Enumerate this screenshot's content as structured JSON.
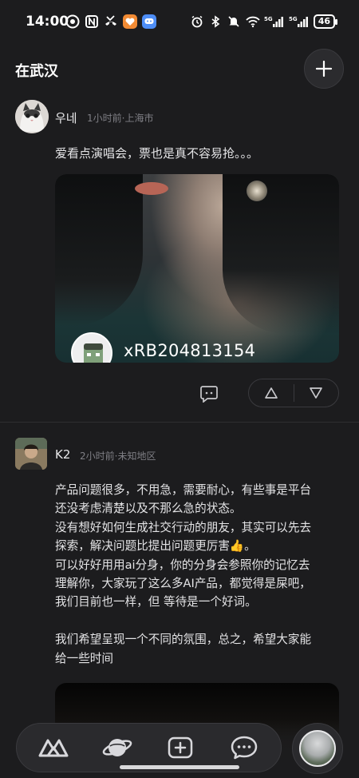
{
  "status_bar": {
    "time": "14:00",
    "battery": "46",
    "left_icons": [
      "signal-app-icon",
      "nfc-icon",
      "missed-call-icon",
      "taobao-icon",
      "message-app-icon"
    ],
    "right_icons": [
      "alarm-icon",
      "bluetooth-icon",
      "mute-icon",
      "wifi-icon",
      "signal-5g-icon",
      "signal-5g-icon"
    ]
  },
  "header": {
    "title": "在武汉",
    "add_icon": "plus-icon"
  },
  "posts": [
    {
      "author": "우네",
      "meta": "1小时前·上海市",
      "text": "爱看点演唱会，票也是真不容易抢。。。",
      "card_name": "xRB204813154",
      "actions": {
        "comment_icon": "comment-icon",
        "upvote_icon": "triangle-up-icon",
        "downvote_icon": "triangle-down-icon"
      }
    },
    {
      "author": "K2",
      "meta": "2小时前·未知地区",
      "text": "产品问题很多，不用急，需要耐心，有些事是平台\n还没考虑清楚以及不那么急的状态。\n没有想好如何生成社交行动的朋友，其实可以先去\n探索，解决问题比提出问题更厉害👍。\n可以好好用用ai分身，你的分身会参照你的记忆去\n理解你，大家玩了这么多AI产品，都觉得是屎吧，\n我们目前也一样，但 等待是一个好词。\n\n我们希望呈现一个不同的氛围，总之，希望大家能\n给一些时间"
    }
  ],
  "bottom_nav": {
    "items": [
      "home-logo-icon",
      "planet-icon",
      "add-post-icon",
      "chat-icon"
    ],
    "profile": "profile-avatar"
  }
}
